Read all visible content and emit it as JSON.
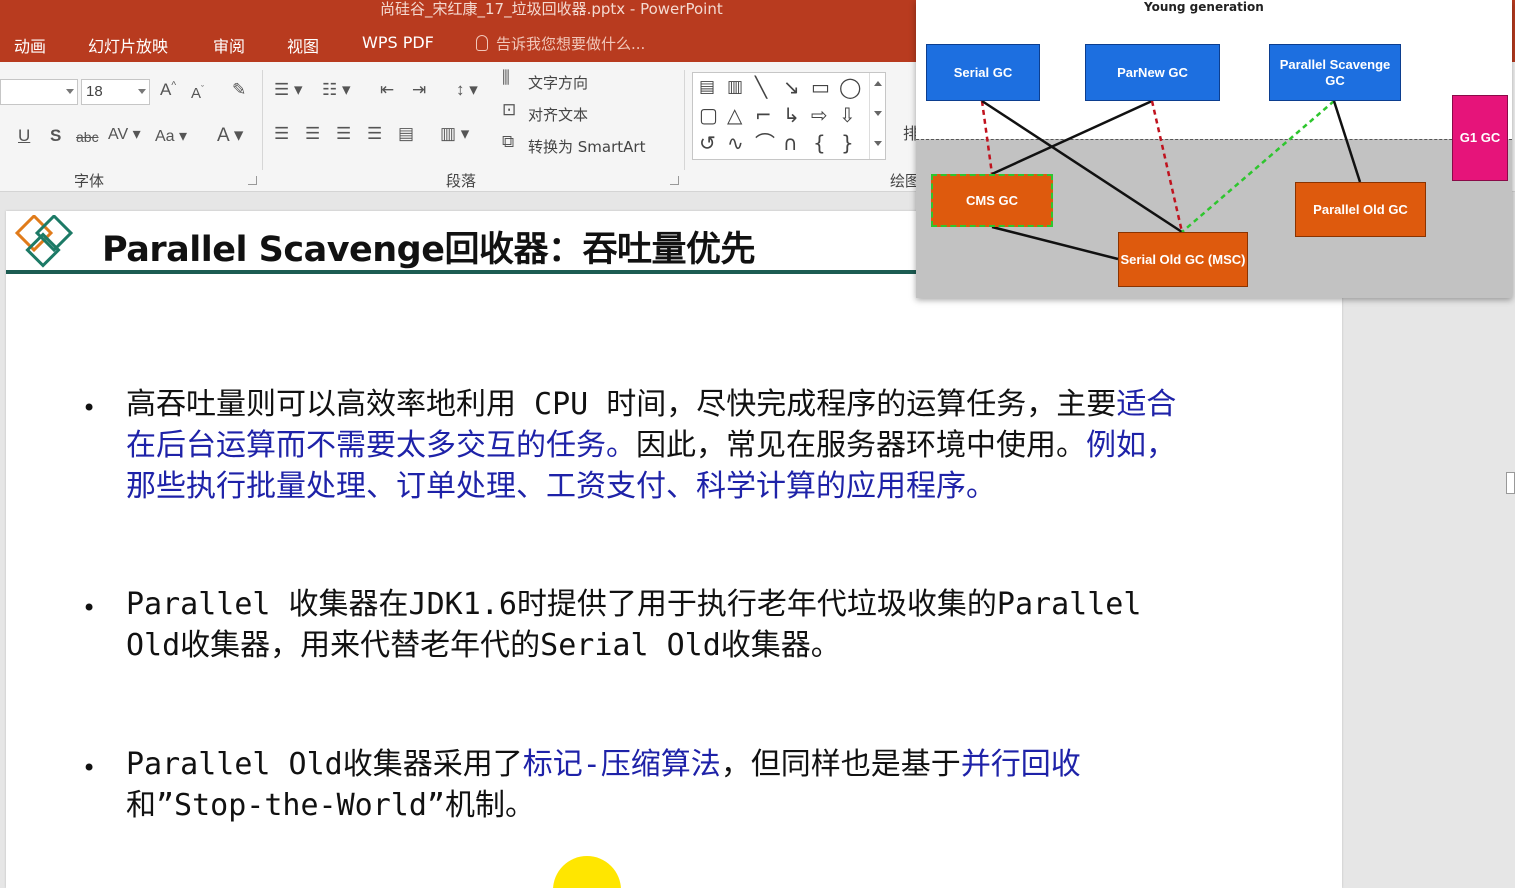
{
  "window": {
    "title": "尚硅谷_宋红康_17_垃圾回收器.pptx - PowerPoint"
  },
  "tabs": [
    "动画",
    "幻灯片放映",
    "审阅",
    "视图",
    "WPS PDF"
  ],
  "tell_me": {
    "placeholder": "告诉我您想要做什么..."
  },
  "ribbon": {
    "font_size": "18",
    "text_direction": "文字方向",
    "align_text": "对齐文本",
    "convert_smartart": "转换为 SmartArt",
    "groups": {
      "font": "字体",
      "paragraph": "段落",
      "drawing": "绘图"
    },
    "arrange_partial": "排"
  },
  "slide": {
    "title": "Parallel Scavenge回收器：吞吐量优先",
    "bullets": [
      {
        "parts": [
          {
            "text": "高吞吐量则可以高效率地利用 CPU 时间，尽快完成程序的运算任务，主要",
            "highlight": false
          },
          {
            "text": "适合在后台运算而不需要太多交互的任务。",
            "highlight": true
          },
          {
            "text": "因此，常见在服务器环境中使用。",
            "highlight": false
          },
          {
            "text": "例如，那些执行批量处理、订单处理、工资支付、科学计算的应用程序。",
            "highlight": true
          }
        ]
      },
      {
        "parts": [
          {
            "text": "Parallel 收集器在JDK1.6时提供了用于执行老年代垃圾收集的Parallel Old收集器，用来代替老年代的Serial Old收集器。",
            "highlight": false
          }
        ]
      },
      {
        "parts": [
          {
            "text": "Parallel Old收集器采用了",
            "highlight": false
          },
          {
            "text": "标记-压缩算法",
            "highlight": true
          },
          {
            "text": "，但同样也是基于",
            "highlight": false
          },
          {
            "text": "并行回收",
            "highlight": true
          },
          {
            "text": "和”Stop-the-World”机制。",
            "highlight": false
          }
        ]
      }
    ]
  },
  "diagram": {
    "young_label": "Young generation",
    "nodes": {
      "serial": "Serial GC",
      "parnew": "ParNew GC",
      "parallel_scavenge": "Parallel Scavenge GC",
      "g1": "G1 GC",
      "cms": "CMS GC",
      "serial_old": "Serial Old GC (MSC)",
      "parallel_old": "Parallel Old GC"
    },
    "colors": {
      "young": "#1d6fe0",
      "old": "#de5a0d",
      "g1": "#e6147a",
      "red_dashed": "#c0121e",
      "green_dashed": "#2ec62e"
    }
  }
}
